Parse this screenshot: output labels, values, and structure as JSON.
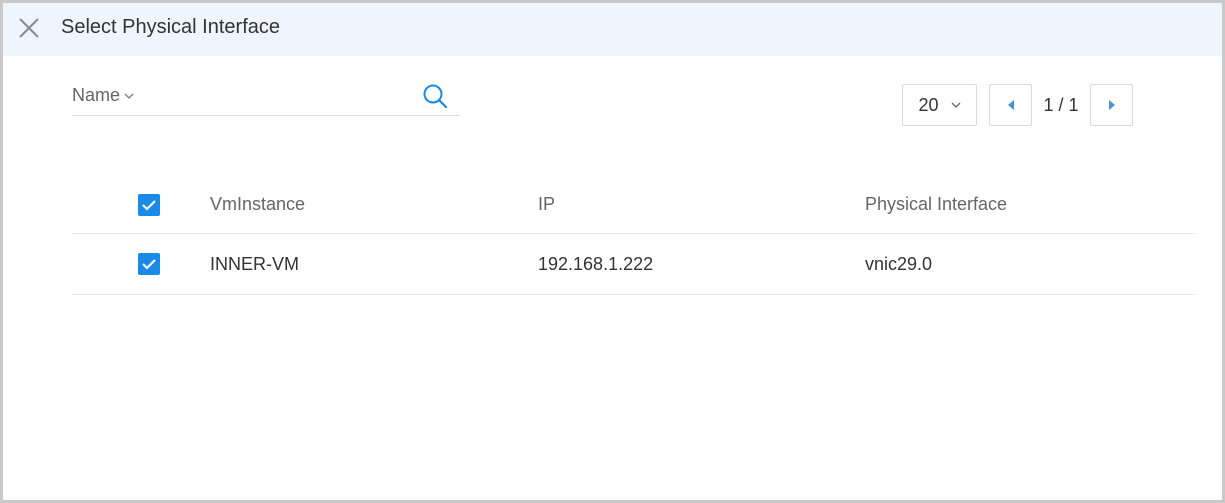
{
  "dialog": {
    "title": "Select Physical Interface"
  },
  "search": {
    "field": "Name",
    "value": "",
    "placeholder": ""
  },
  "pagination": {
    "page_size": "20",
    "indicator": "1 / 1"
  },
  "table": {
    "columns": [
      "VmInstance",
      "IP",
      "Physical Interface"
    ],
    "header_checked": true,
    "rows": [
      {
        "checked": true,
        "vm_instance": "INNER-VM",
        "ip": "192.168.1.222",
        "physical_interface": "vnic29.0"
      }
    ]
  },
  "colors": {
    "accent": "#1a8ae8",
    "header_bg": "#eef5fc"
  }
}
